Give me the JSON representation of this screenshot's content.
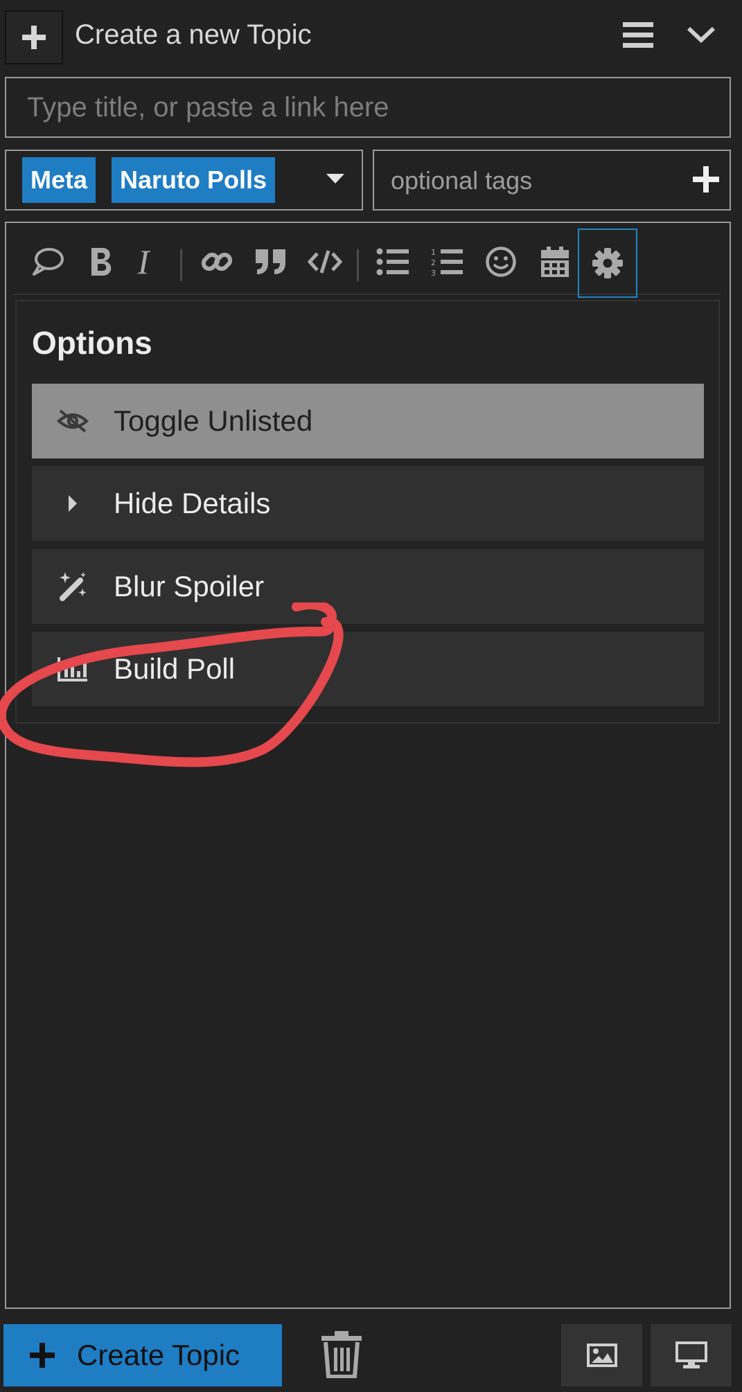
{
  "header": {
    "title": "Create a new Topic"
  },
  "title_input": {
    "placeholder": "Type title, or paste a link here",
    "value": ""
  },
  "categories": [
    {
      "label": "Meta"
    },
    {
      "label": "Naruto Polls"
    }
  ],
  "tags": {
    "placeholder": "optional tags"
  },
  "toolbar": {
    "buttons": [
      "quote-icon",
      "bold-icon",
      "italic-icon",
      "link-icon",
      "blockquote-icon",
      "code-icon",
      "bullet-list-icon",
      "numbered-list-icon",
      "emoji-icon",
      "calendar-icon",
      "gear-icon"
    ],
    "active": "gear-icon",
    "italic_glyph": "I"
  },
  "options": {
    "title": "Options",
    "items": [
      {
        "label": "Toggle Unlisted",
        "icon": "eye-slash-icon",
        "highlighted": true
      },
      {
        "label": "Hide Details",
        "icon": "caret-right-icon"
      },
      {
        "label": "Blur Spoiler",
        "icon": "magic-wand-icon"
      },
      {
        "label": "Build Poll",
        "icon": "chart-bar-icon"
      }
    ]
  },
  "annotation": {
    "shape": "red-circle",
    "target": "Build Poll",
    "color": "#e5484d"
  },
  "footer": {
    "create_label": "Create Topic"
  },
  "colors": {
    "accent": "#1f7dc4",
    "background": "#222222",
    "highlight": "#8f8f8f"
  }
}
